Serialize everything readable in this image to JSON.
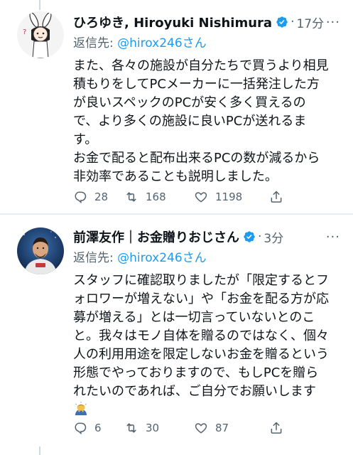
{
  "colors": {
    "accent": "#1d9bf0",
    "secondary_text": "#536471",
    "divider": "#e6ecf0"
  },
  "tweets": [
    {
      "name": "ひろゆき, Hiroyuki Nishimura",
      "verified": true,
      "separator": "·",
      "time": "17分",
      "more": "···",
      "reply_prefix": "返信先: ",
      "reply_handle": "@hirox246さん",
      "text": "また、各々の施設が自分たちで買うより相見\n積もりをしてPCメーカーに一括発注した方\nが良いスペックのPCが安く多く買えるの\nで、より多くの施設に良いPCが送れるま\nす。\nお金で配ると配布出来るPCの数が減るから\n非効率であることも説明しました。",
      "replies": "28",
      "retweets": "168",
      "likes": "1198",
      "avatar_icon": "illustrated-character-avatar-icon"
    },
    {
      "name": "前澤友作｜お金贈りおじさん",
      "verified": true,
      "separator": "·",
      "time": "3分",
      "more": "···",
      "reply_prefix": "返信先: ",
      "reply_handle": "@hirox246さん",
      "text": "スタッフに確認取りましたが「限定するとフ\nォロワーが増えない」や「お金を配る方が応\n募が増える」とは一切言っていないとのこ\nと。我々はモノ自体を贈るのではなく、個々\n人の利用用途を限定しないお金を贈るという\n形態でやっておりますので、もしPCを贈ら\nれたいのであれば、ご自分でお願いします",
      "emoji_icon": "bowing-person-emoji-icon",
      "replies": "6",
      "retweets": "30",
      "likes": "87",
      "avatar_icon": "astronaut-photo-avatar-icon"
    }
  ]
}
